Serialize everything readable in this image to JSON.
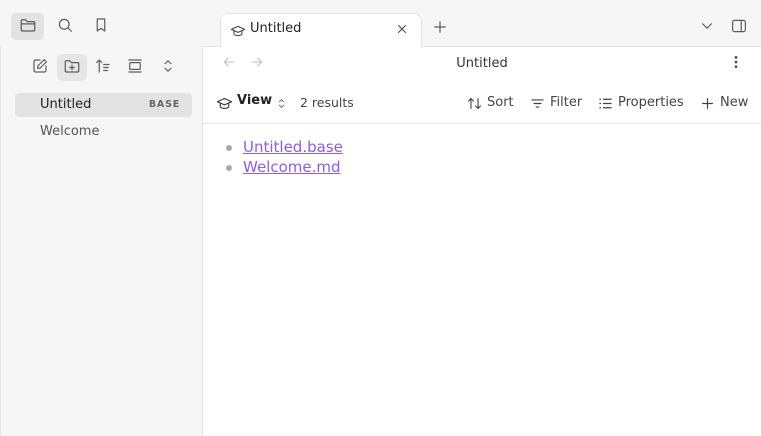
{
  "tab": {
    "title": "Untitled"
  },
  "sidebar": {
    "files": [
      {
        "label": "Untitled",
        "badge": "BASE"
      },
      {
        "label": "Welcome"
      }
    ]
  },
  "nav": {
    "title": "Untitled"
  },
  "toolbar": {
    "view_label": "View",
    "results_count": "2 results",
    "sort_label": "Sort",
    "filter_label": "Filter",
    "properties_label": "Properties",
    "new_label": "New"
  },
  "results": [
    "Untitled.base",
    "Welcome.md"
  ],
  "colors": {
    "link": "#8a5cf5",
    "active_bg": "#e3e3e3",
    "panel_bg": "#f6f6f6"
  },
  "icons": [
    "files-icon",
    "search-icon",
    "bookmark-icon",
    "new-note-icon",
    "new-folder-icon",
    "sort-icon",
    "collapse-icon",
    "expand-icon",
    "base-icon",
    "close-icon",
    "plus-icon",
    "chevron-down-icon",
    "sidebar-toggle-icon",
    "back-icon",
    "forward-icon",
    "more-icon",
    "updown-icon",
    "filter-icon",
    "properties-icon"
  ]
}
